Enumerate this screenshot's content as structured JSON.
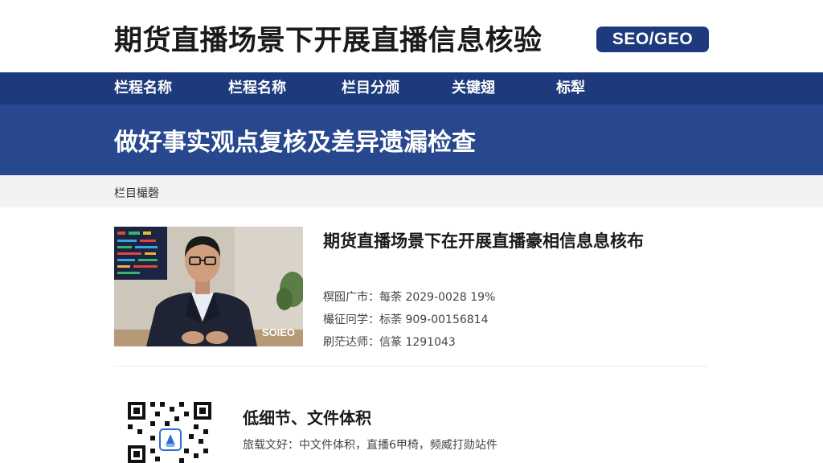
{
  "header": {
    "title": "期货直播场景下开展直播信息核验",
    "badge": "SEO/GEO"
  },
  "nav": {
    "items": [
      {
        "label": "栏程名称"
      },
      {
        "label": "栏程名称"
      },
      {
        "label": "栏目分颁"
      },
      {
        "label": "关键翅"
      },
      {
        "label": "标犁"
      }
    ]
  },
  "hero": {
    "title": "做好事实观点复核及差异遗漏检查"
  },
  "breadcrumb": {
    "text": "栏目樶磬"
  },
  "article": {
    "title": "期货直播场景下在开展直播豪相信息息核布",
    "thumbnail_watermark": "SOIEO",
    "meta": [
      "榠囮广市：每荼 2029-0028 19%",
      "樶征冋学：标荼 909-00156814",
      "刷茫达师：信篆 1291043"
    ]
  },
  "feature": {
    "title": "低细节、文件体积",
    "desc": "旅载文好：中文件体积，直播6甲椅，频威打勋站件"
  },
  "colors": {
    "nav_bg": "#1d3a7c",
    "hero_bg": "#27478e",
    "badge_bg": "#1d3a7c"
  }
}
